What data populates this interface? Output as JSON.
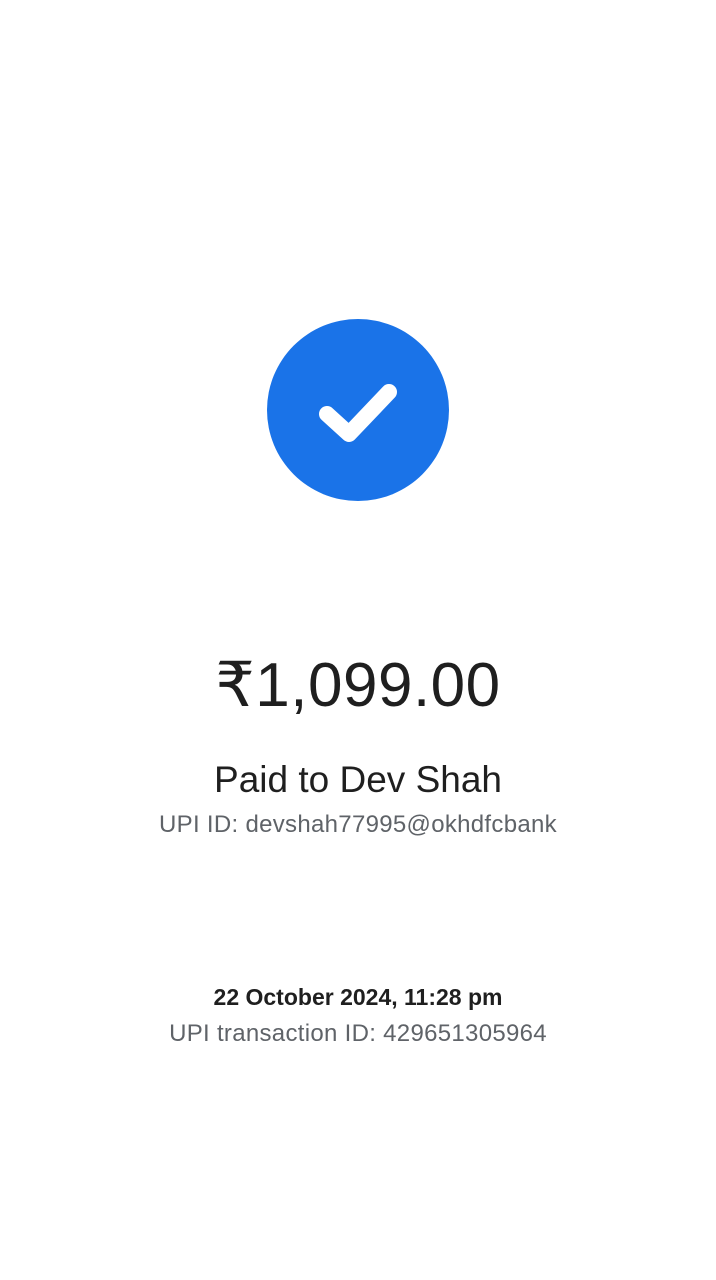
{
  "theme": {
    "accent": "#1a73e8",
    "text_primary": "#1f1f1f",
    "text_secondary": "#5f6368",
    "background": "#ffffff"
  },
  "status": {
    "icon": "check-circle-icon"
  },
  "payment": {
    "amount": "₹1,099.00",
    "paid_to": "Paid to Dev Shah",
    "upi_id_label": "UPI ID:",
    "upi_id_value": "devshah77995@okhdfcbank"
  },
  "transaction": {
    "datetime": "22 October 2024, 11:28 pm",
    "txn_id_label": "UPI transaction ID:",
    "txn_id_value": "429651305964"
  }
}
